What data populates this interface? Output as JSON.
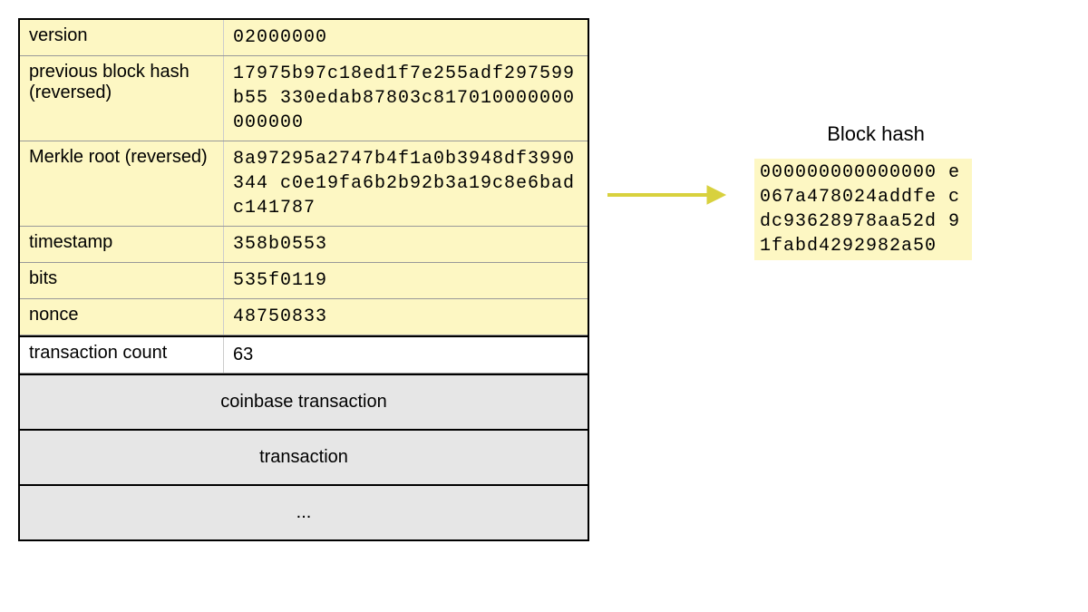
{
  "block": {
    "header_rows": [
      {
        "label": "version",
        "value": "02000000"
      },
      {
        "label": "previous block hash (reversed)",
        "value": "17975b97c18ed1f7e255adf297599b55 330edab87803c817010000000000000"
      },
      {
        "label": "Merkle root (reversed)",
        "value": "8a97295a2747b4f1a0b3948df3990344 c0e19fa6b2b92b3a19c8e6badc141787"
      },
      {
        "label": "timestamp",
        "value": "358b0553"
      },
      {
        "label": "bits",
        "value": "535f0119"
      },
      {
        "label": "nonce",
        "value": "48750833"
      }
    ],
    "tx_count": {
      "label": "transaction count",
      "value": "63"
    },
    "body_rows": [
      "coinbase transaction",
      "transaction",
      "..."
    ]
  },
  "output": {
    "title": "Block hash",
    "hash": "000000000000000 e067a478024addfe cdc93628978aa52d 91fabd4292982a50"
  }
}
